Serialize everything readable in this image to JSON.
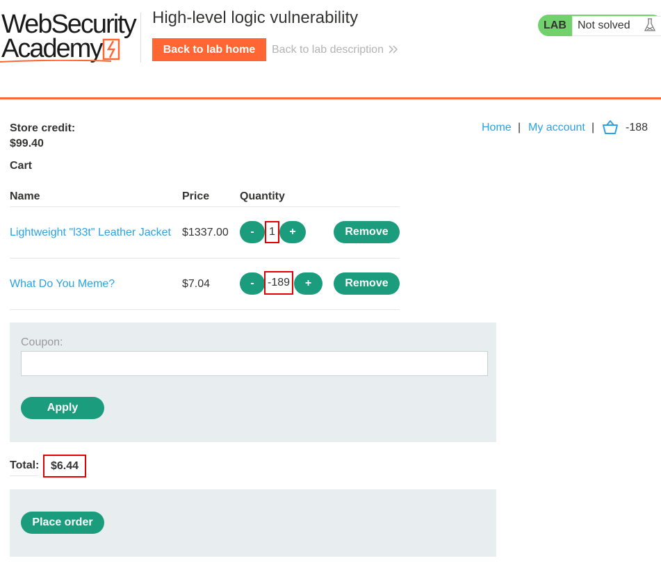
{
  "header": {
    "logo_line1": "WebSecurity",
    "logo_line2": "Academy",
    "lab_title": "High-level logic vulnerability",
    "back_home": "Back to lab home",
    "back_desc": "Back to lab description",
    "status_badge": "LAB",
    "status_text": "Not solved",
    "accent_color": "#ff6633",
    "status_color": "#70d16d"
  },
  "nav": {
    "home": "Home",
    "sep": "|",
    "account": "My account",
    "cart_count": "-188"
  },
  "store": {
    "credit_label": "Store credit:",
    "credit_value": "$99.40",
    "cart_label": "Cart"
  },
  "table": {
    "headers": [
      "Name",
      "Price",
      "Quantity"
    ],
    "rows": [
      {
        "name": "Lightweight \"l33t\" Leather Jacket",
        "price": "$1337.00",
        "qty": "1",
        "minus": "-",
        "plus": "+",
        "remove": "Remove"
      },
      {
        "name": "What Do You Meme?",
        "price": "$7.04",
        "qty": "-189",
        "minus": "-",
        "plus": "+",
        "remove": "Remove"
      }
    ]
  },
  "coupon": {
    "label": "Coupon:",
    "value": "",
    "apply": "Apply"
  },
  "total": {
    "label": "Total:",
    "value": "$6.44"
  },
  "order": {
    "place": "Place order"
  },
  "button_color": "#1a9c7d",
  "link_color": "#29a2e6"
}
